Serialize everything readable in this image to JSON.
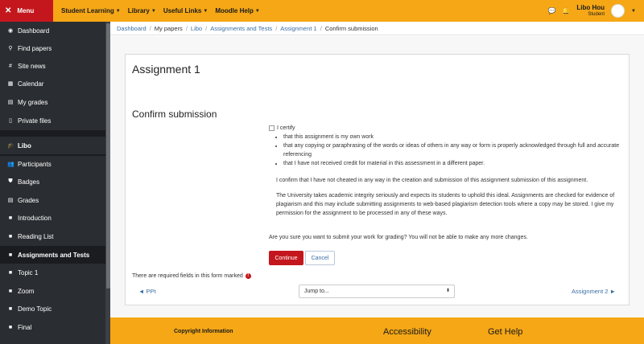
{
  "topbar": {
    "menu_label": "Menu",
    "nav": [
      {
        "label": "Student Learning"
      },
      {
        "label": "Library"
      },
      {
        "label": "Useful Links"
      },
      {
        "label": "Moodle Help"
      }
    ],
    "user_name": "Libo Hou",
    "user_role": "Student"
  },
  "sidebar": {
    "items": [
      {
        "label": "Dashboard",
        "icon": "dashboard-icon"
      },
      {
        "label": "Find papers",
        "icon": "search-icon"
      },
      {
        "label": "Site news",
        "icon": "hashtag-icon"
      },
      {
        "label": "Calendar",
        "icon": "calendar-icon"
      },
      {
        "label": "My grades",
        "icon": "table-icon"
      },
      {
        "label": "Private files",
        "icon": "file-icon"
      },
      {
        "label": "Libo",
        "icon": "graduation-cap-icon"
      },
      {
        "label": "Participants",
        "icon": "users-icon"
      },
      {
        "label": "Badges",
        "icon": "shield-icon"
      },
      {
        "label": "Grades",
        "icon": "table-icon"
      },
      {
        "label": "Introduction",
        "icon": "folder-icon"
      },
      {
        "label": "Reading List",
        "icon": "folder-icon"
      },
      {
        "label": "Assignments and Tests",
        "icon": "folder-icon"
      },
      {
        "label": "Topic 1",
        "icon": "folder-icon"
      },
      {
        "label": "Zoom",
        "icon": "folder-icon"
      },
      {
        "label": "Demo Topic",
        "icon": "folder-icon"
      },
      {
        "label": "Final",
        "icon": "folder-icon"
      }
    ]
  },
  "breadcrumb": [
    "Dashboard",
    "My papers",
    "Libo",
    "Assignments and Tests",
    "Assignment 1",
    "Confirm submission"
  ],
  "main": {
    "assignment_title": "Assignment 1",
    "section_title": "Confirm submission",
    "certify_label": "I certify",
    "bullets": [
      "that this assignment is my own work",
      "that any copying or paraphrasing of the words or ideas of others in any way or form is properly acknowledged through full and accurate referencing",
      "that I have not received credit for material in this assessment in a different paper."
    ],
    "para1": "I confirm that I have not cheated in any way in the creation and submission of this assignment submission of this assignment.",
    "para2": "The University takes academic integrity seriously and expects its students to uphold this ideal. Assignments are checked for evidence of plagiarism and this may include submitting assignments to web-based plagiarism detection tools where a copy may be stored. I give my permission for the assignment to be processed in any of these ways.",
    "question": "Are you sure you want to submit your work for grading? You will not be able to make any more changes.",
    "continue_label": "Continue",
    "cancel_label": "Cancel",
    "required_text": "There are required fields in this form marked",
    "prev_link": "◄ PPt",
    "jump_placeholder": "Jump to...",
    "next_link": "Assignment 2 ►"
  },
  "footer": {
    "copyright": "Copyright Information",
    "accessibility": "Accessibility",
    "help": "Get Help"
  },
  "colors": {
    "accent": "#f5a716",
    "brand_red": "#c4171d",
    "sidebar_bg": "#2a2d31",
    "link": "#3a6ea5"
  }
}
